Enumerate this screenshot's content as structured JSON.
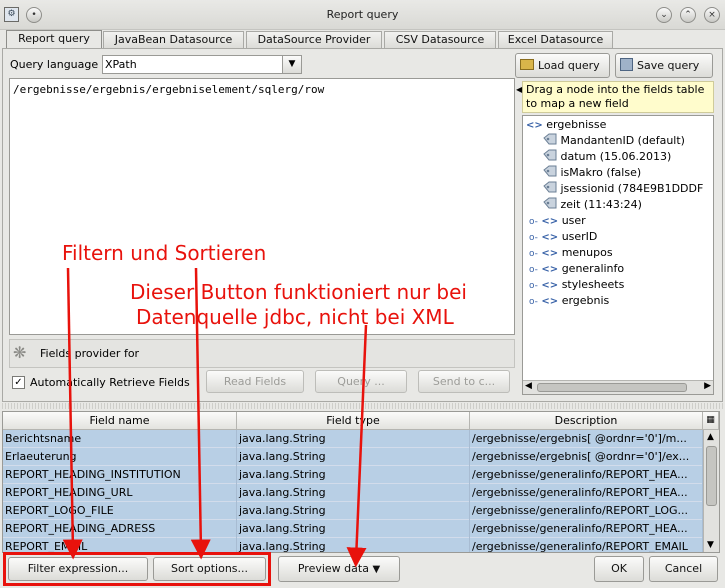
{
  "window": {
    "title": "Report query"
  },
  "tabs": [
    "Report query",
    "JavaBean Datasource",
    "DataSource Provider",
    "CSV Datasource",
    "Excel Datasource"
  ],
  "query": {
    "language_label": "Query language",
    "language_value": "XPath",
    "text": "/ergebnisse/ergebnis/ergebniselement/sqlerg/row"
  },
  "right_panel": {
    "load_query": "Load query",
    "save_query": "Save query",
    "hint": "Drag a node into the fields table to map a new field"
  },
  "tree": {
    "root": "ergebnisse",
    "attributes": [
      "MandantenID (default)",
      "datum (15.06.2013)",
      "isMakro (false)",
      "jsessionid (784E9B1DDDF",
      "zeit (11:43:24)"
    ],
    "nodes": [
      "user",
      "userID",
      "menupos",
      "generalinfo",
      "stylesheets",
      "ergebnis"
    ]
  },
  "provider": {
    "label": "Fields provider for",
    "auto_retrieve": "Automatically Retrieve Fields",
    "read_fields": "Read Fields",
    "query": "Query ...",
    "send_to": "Send to c..."
  },
  "table": {
    "columns": [
      "Field name",
      "Field type",
      "Description"
    ],
    "rows": [
      [
        "Berichtsname",
        "java.lang.String",
        "/ergebnisse/ergebnis[ @ordnr='0']/m..."
      ],
      [
        "Erlaeuterung",
        "java.lang.String",
        "/ergebnisse/ergebnis[ @ordnr='0']/ex..."
      ],
      [
        "REPORT_HEADING_INSTITUTION",
        "java.lang.String",
        "/ergebnisse/generalinfo/REPORT_HEA..."
      ],
      [
        "REPORT_HEADING_URL",
        "java.lang.String",
        "/ergebnisse/generalinfo/REPORT_HEA..."
      ],
      [
        "REPORT_LOGO_FILE",
        "java.lang.String",
        "/ergebnisse/generalinfo/REPORT_LOG..."
      ],
      [
        "REPORT_HEADING_ADRESS",
        "java.lang.String",
        "/ergebnisse/generalinfo/REPORT_HEA..."
      ],
      [
        "REPORT_EMAIL",
        "java.lang.String",
        "/ergebnisse/generalinfo/REPORT_EMAIL"
      ]
    ]
  },
  "bottom": {
    "filter": "Filter expression...",
    "sort": "Sort options...",
    "preview": "Preview data",
    "ok": "OK",
    "cancel": "Cancel"
  },
  "annotations": {
    "filter_sort": "Filtern und Sortieren",
    "button_note_1": "Dieser Button funktioniert nur bei",
    "button_note_2": "Datenquelle jdbc, nicht bei XML"
  },
  "colors": {
    "annotation": "#e8120c",
    "selection": "#b8cfe5",
    "accent": "#3a63a8"
  }
}
